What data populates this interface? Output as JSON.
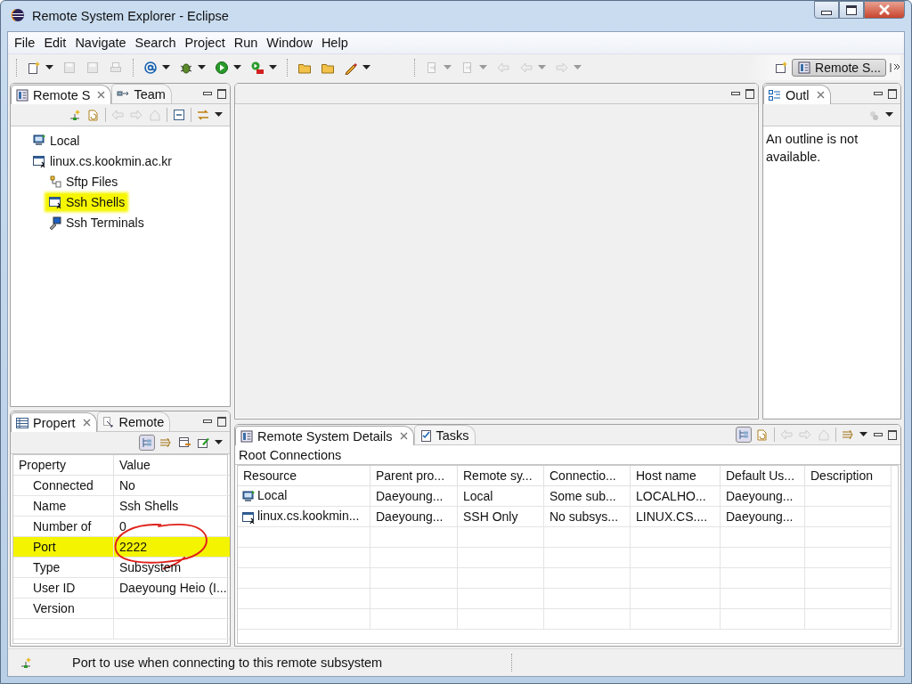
{
  "window": {
    "title": "Remote System Explorer - Eclipse"
  },
  "menu": [
    "File",
    "Edit",
    "Navigate",
    "Search",
    "Project",
    "Run",
    "Window",
    "Help"
  ],
  "toolbar": [
    {
      "kind": "new",
      "disabled": false,
      "dropdown": true
    },
    {
      "kind": "save",
      "disabled": true
    },
    {
      "kind": "save",
      "disabled": true
    },
    {
      "kind": "print",
      "disabled": true
    },
    {
      "kind": "sep"
    },
    {
      "kind": "at",
      "disabled": false,
      "dropdown": true
    },
    {
      "kind": "bug",
      "disabled": false,
      "dropdown": true
    },
    {
      "kind": "run",
      "disabled": false,
      "dropdown": true
    },
    {
      "kind": "tool",
      "disabled": false,
      "dropdown": true
    },
    {
      "kind": "sep"
    },
    {
      "kind": "folder",
      "disabled": false
    },
    {
      "kind": "folder",
      "disabled": false
    },
    {
      "kind": "pen",
      "disabled": false,
      "dropdown": true
    },
    {
      "kind": "gap"
    },
    {
      "kind": "sep"
    },
    {
      "kind": "nav",
      "disabled": true,
      "dropdown": true
    },
    {
      "kind": "nav",
      "disabled": true,
      "dropdown": true
    },
    {
      "kind": "back",
      "disabled": true
    },
    {
      "kind": "back",
      "disabled": true,
      "dropdown": true
    },
    {
      "kind": "forward",
      "disabled": true,
      "dropdown": true
    }
  ],
  "perspective": {
    "label": "Remote S...",
    "selected": true
  },
  "remote_systems": {
    "tabs": [
      {
        "label": "Remote S",
        "selected": true
      },
      {
        "label": "Team",
        "selected": false
      }
    ],
    "tree": [
      {
        "label": "Local",
        "kind": "computer",
        "highlighted": false
      },
      {
        "label": "linux.cs.kookmin.ac.kr",
        "kind": "shell",
        "highlighted": false,
        "children": [
          {
            "label": "Sftp Files",
            "kind": "files",
            "highlighted": false
          },
          {
            "label": "Ssh Shells",
            "kind": "shell",
            "highlighted": true
          },
          {
            "label": "Ssh Terminals",
            "kind": "terminal",
            "highlighted": false
          }
        ]
      }
    ]
  },
  "outline": {
    "tabs": [
      {
        "label": "Outl",
        "selected": true
      }
    ],
    "message": "An outline is not available."
  },
  "properties": {
    "tabs": [
      {
        "label": "Propert",
        "selected": true
      },
      {
        "label": "Remote",
        "selected": false
      }
    ],
    "columns": [
      "Property",
      "Value"
    ],
    "rows": [
      {
        "property": "Connected",
        "value": "No",
        "highlighted": false
      },
      {
        "property": "Name",
        "value": "Ssh Shells",
        "highlighted": false
      },
      {
        "property": "Number of",
        "value": "0",
        "highlighted": false
      },
      {
        "property": "Port",
        "value": "2222",
        "highlighted": true,
        "circled": true
      },
      {
        "property": "Type",
        "value": "Subsystem",
        "highlighted": false
      },
      {
        "property": "User ID",
        "value": "Daeyoung Heio (I...",
        "highlighted": false
      },
      {
        "property": "Version",
        "value": "",
        "highlighted": false
      }
    ]
  },
  "details": {
    "tabs": [
      {
        "label": "Remote System Details",
        "selected": true
      },
      {
        "label": "Tasks",
        "selected": false
      }
    ],
    "caption": "Root Connections",
    "columns": [
      "Resource",
      "Parent pro...",
      "Remote sy...",
      "Connectio...",
      "Host name",
      "Default Us...",
      "Description"
    ],
    "rows": [
      {
        "kind": "computer",
        "cells": [
          "Local",
          "Daeyoung...",
          "Local",
          "Some sub...",
          "LOCALHO...",
          "Daeyoung...",
          ""
        ]
      },
      {
        "kind": "shell",
        "cells": [
          "linux.cs.kookmin...",
          "Daeyoung...",
          "SSH Only",
          "No subsys...",
          "LINUX.CS....",
          "Daeyoung...",
          ""
        ]
      }
    ]
  },
  "status_bar": {
    "message": "Port to use when connecting to this remote subsystem"
  }
}
